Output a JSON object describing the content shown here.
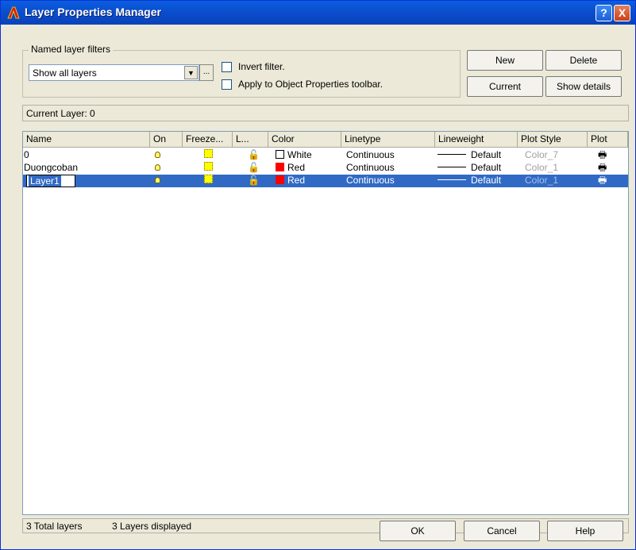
{
  "window": {
    "title": "Layer Properties Manager",
    "help_label": "?",
    "close_label": "X"
  },
  "filters": {
    "legend": "Named layer filters",
    "selected": "Show all layers",
    "browse_label": "...",
    "invert_label": "Invert filter.",
    "apply_label": "Apply to Object Properties toolbar."
  },
  "buttons": {
    "new": "New",
    "delete": "Delete",
    "current": "Current",
    "show_details": "Show details",
    "ok": "OK",
    "cancel": "Cancel",
    "help": "Help"
  },
  "current_layer": "Current Layer:  0",
  "columns": [
    "Name",
    "On",
    "Freeze...",
    "L...",
    "Color",
    "Linetype",
    "Lineweight",
    "Plot Style",
    "Plot"
  ],
  "layers": [
    {
      "name": "0",
      "color_name": "White",
      "color_hex": "#ffffff",
      "linetype": "Continuous",
      "lineweight": "Default",
      "plot_style": "Color_7"
    },
    {
      "name": "Duongcoban",
      "color_name": "Red",
      "color_hex": "#ff0000",
      "linetype": "Continuous",
      "lineweight": "Default",
      "plot_style": "Color_1"
    },
    {
      "name": "Layer1",
      "color_name": "Red",
      "color_hex": "#ff0000",
      "linetype": "Continuous",
      "lineweight": "Default",
      "plot_style": "Color_1"
    }
  ],
  "status": {
    "total": "3 Total layers",
    "displayed": "3 Layers displayed"
  },
  "icons": {
    "on": "lightbulb-icon",
    "freeze": "sun-icon",
    "lock": "unlocked-padlock-icon",
    "plot": "printer-icon"
  },
  "colors": {
    "titlebar": "#0b4fd0",
    "selection": "#316ac5",
    "dialog": "#ece9d8"
  }
}
